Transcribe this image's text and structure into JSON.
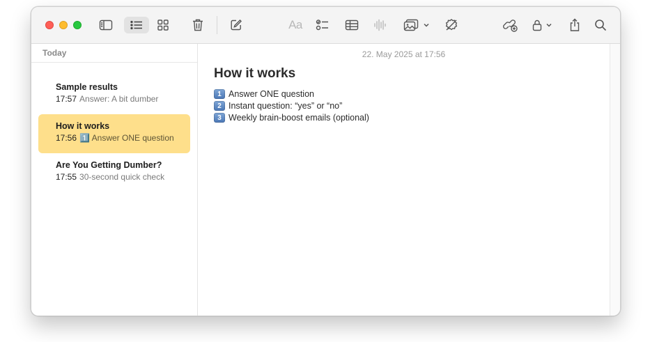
{
  "toolbar": {
    "format_label": "Aa"
  },
  "sidebar": {
    "section": "Today",
    "notes": [
      {
        "title": "Sample results",
        "time": "17:57",
        "preview": "Answer: A bit dumber"
      },
      {
        "title": "How it works",
        "time": "17:56",
        "preview": "1️⃣ Answer ONE question"
      },
      {
        "title": "Are You Getting Dumber?",
        "time": "17:55",
        "preview": "30-second quick check"
      }
    ]
  },
  "note": {
    "date": "22. May 2025 at 17:56",
    "title": "How it works",
    "lines": [
      {
        "num": "1",
        "text": "Answer ONE question"
      },
      {
        "num": "2",
        "text": "Instant question: “yes” or “no”"
      },
      {
        "num": "3",
        "text": "Weekly brain-boost emails (optional)"
      }
    ]
  },
  "icons": {
    "sidebar_toggle": "sidebar-icon",
    "list_view": "list-view-icon",
    "gallery_view": "gallery-view-icon",
    "delete": "trash-icon",
    "compose": "compose-icon",
    "checklist": "checklist-icon",
    "table": "table-icon",
    "audio": "waveform-icon",
    "media": "photo-icon",
    "collaborate": "collaborate-icon",
    "link": "link-icon",
    "lock": "lock-icon",
    "share": "share-icon",
    "search": "search-icon"
  },
  "colors": {
    "selected_note": "#fedf8b",
    "close": "#ff5f57",
    "minimize": "#febc2e",
    "zoom": "#28c840"
  }
}
